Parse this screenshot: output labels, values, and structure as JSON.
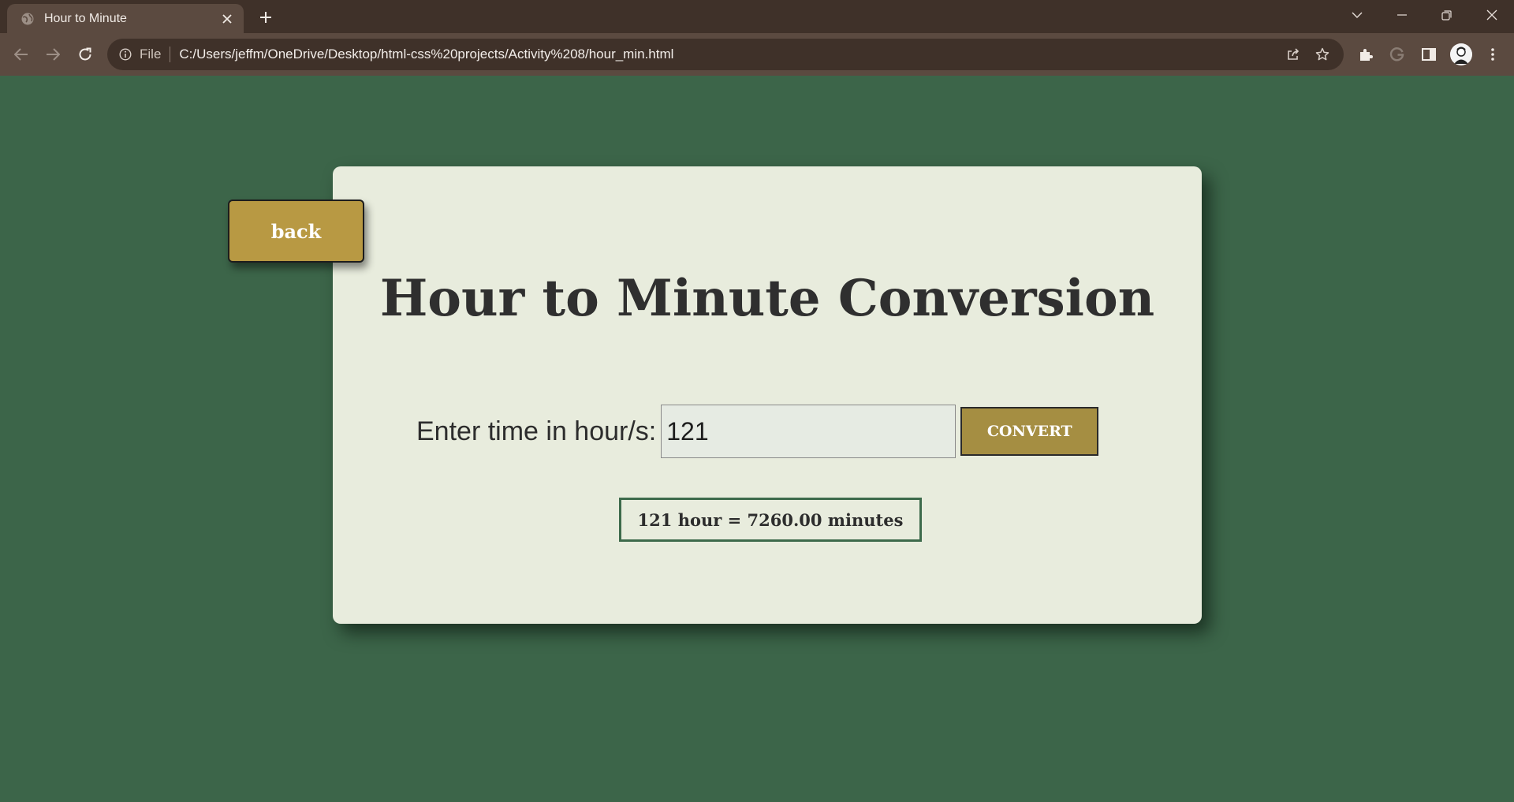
{
  "browser": {
    "tab": {
      "title": "Hour to Minute",
      "favicon": "globe-icon",
      "close": "close-icon"
    },
    "new_tab": "plus-icon",
    "window_controls": [
      "chevron-down-icon",
      "minimize-icon",
      "restore-icon",
      "close-icon"
    ],
    "toolbar": {
      "back": "arrow-left-icon",
      "forward": "arrow-right-icon",
      "reload": "reload-icon",
      "scheme_label": "File",
      "url": "C:/Users/jeffm/OneDrive/Desktop/html-css%20projects/Activity%208/hour_min.html",
      "right_icons": [
        "share-icon",
        "star-icon",
        "puzzle-icon",
        "g-icon",
        "sidebar-icon",
        "avatar",
        "kebab-icon"
      ]
    }
  },
  "page": {
    "back_label": "back",
    "title": "Hour to Minute Conversion",
    "input_label": "Enter time in hour/s:",
    "input_value": "121",
    "convert_label": "CONVERT",
    "result": "121 hour = 7260.00 minutes"
  },
  "colors": {
    "page_bg": "#3c6549",
    "card_bg": "#e8ecdd",
    "back_button": "#b89943",
    "convert_button": "#a58e42",
    "result_border": "#3d6a4b",
    "title_text": "#2f2f2f",
    "browser_frame": "#3f3129",
    "browser_toolbar": "#5b4a40"
  }
}
